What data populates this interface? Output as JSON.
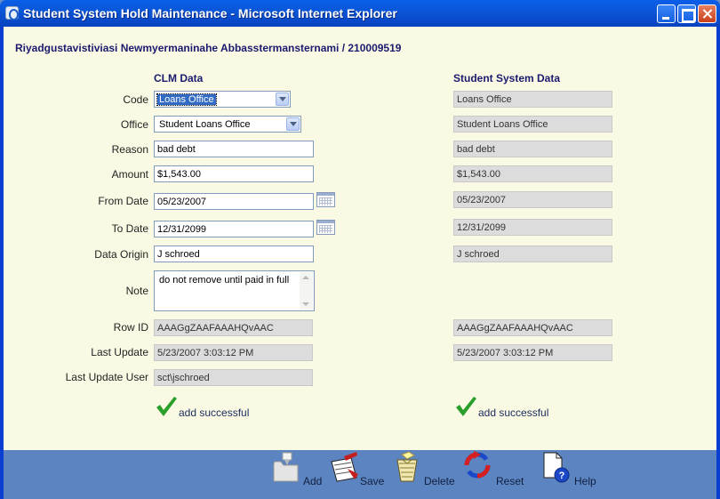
{
  "window": {
    "title": "Student System Hold Maintenance - Microsoft Internet Explorer"
  },
  "student": {
    "heading": "Riyadgustavistiviasi Newmyermaninahe Abbasstermansternami / 210009519"
  },
  "columns": {
    "clm": "CLM Data",
    "student_system": "Student System Data"
  },
  "labels": {
    "code": "Code",
    "office": "Office",
    "reason": "Reason",
    "amount": "Amount",
    "from_date": "From Date",
    "to_date": "To Date",
    "data_origin": "Data Origin",
    "note": "Note",
    "row_id": "Row ID",
    "last_update": "Last Update",
    "last_update_user": "Last Update User"
  },
  "clm": {
    "code": "Loans Office",
    "office": "Student Loans Office",
    "reason": "bad debt",
    "amount": "$1,543.00",
    "from_date": "05/23/2007",
    "to_date": "12/31/2099",
    "data_origin": "J schroed",
    "note": "do not remove until paid in full",
    "row_id": "AAAGgZAAFAAAHQvAAC",
    "last_update": "5/23/2007 3:03:12 PM",
    "last_update_user": "sct\\jschroed",
    "status": "add successful"
  },
  "student_system": {
    "code": "Loans Office",
    "office": "Student Loans Office",
    "reason": "bad debt",
    "amount": "$1,543.00",
    "from_date": "05/23/2007",
    "to_date": "12/31/2099",
    "data_origin": "J schroed",
    "row_id": "AAAGgZAAFAAAHQvAAC",
    "last_update": "5/23/2007 3:03:12 PM",
    "status": "add successful"
  },
  "toolbar": {
    "add": "Add",
    "save": "Save",
    "delete": "Delete",
    "reset": "Reset",
    "help": "Help"
  },
  "colors": {
    "title_bar": "#0a56d8",
    "content_bg": "#fafae4",
    "toolbar_bg": "#5c84c0",
    "check_green": "#2aa02a",
    "heading_text": "#1a1a6e"
  },
  "icons": {
    "window": "ie-icon",
    "calendar": "calendar-icon",
    "success": "checkmark-icon",
    "add": "folder-add-icon",
    "save": "save-icon",
    "delete": "trash-icon",
    "reset": "reset-icon",
    "help": "help-icon"
  }
}
